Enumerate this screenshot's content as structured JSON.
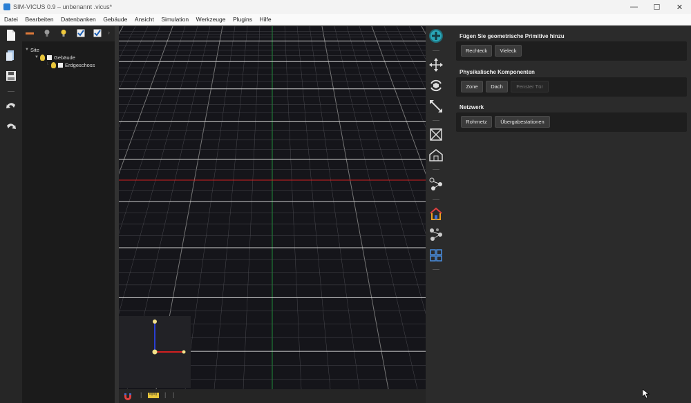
{
  "window": {
    "title": "SIM-VICUS 0.9 – unbenannt .vicus*",
    "controls": {
      "minimize": "—",
      "maximize": "☐",
      "close": "✕"
    }
  },
  "menu": [
    "Datei",
    "Bearbeiten",
    "Datenbanken",
    "Gebäude",
    "Ansicht",
    "Simulation",
    "Werkzeuge",
    "Plugins",
    "Hilfe"
  ],
  "tree": {
    "root": "Site",
    "building": "Gebäude",
    "storey": "Erdgeschoss"
  },
  "panel": {
    "primitives": {
      "title": "Fügen Sie geometrische Primitive hinzu",
      "buttons": [
        "Rechteck",
        "Vieleck"
      ]
    },
    "physical": {
      "title": "Physikalische Komponenten",
      "buttons": [
        "Zone",
        "Dach"
      ],
      "disabled_button": "Fenster Tür"
    },
    "network": {
      "title": "Netzwerk",
      "buttons": [
        "Rohrnetz",
        "Übergabestationen"
      ]
    }
  },
  "colors": {
    "accent": "#2aa7b8",
    "x_axis": "#d42020",
    "y_axis": "#2a3fd4",
    "grid_major": "#cfcfcf",
    "grid_minor": "#4a4a50",
    "grid_center": "#1f8a3a"
  },
  "icons": {
    "left_toolbar": [
      "new-file-icon",
      "open-file-icon",
      "save-icon",
      "undo-icon",
      "redo-icon"
    ],
    "tree_toolbar": [
      "remove-icon",
      "bulb-off-icon",
      "bulb-on-icon",
      "check-all-icon",
      "check-selected-icon",
      "more-icon"
    ],
    "right_toolbar": [
      "add-geometry-icon",
      "translate-icon",
      "rotate-icon",
      "scale-icon",
      "deselect-icon",
      "building-icon",
      "network-icon",
      "color-building-icon",
      "color-network-icon",
      "site-grid-icon"
    ]
  }
}
